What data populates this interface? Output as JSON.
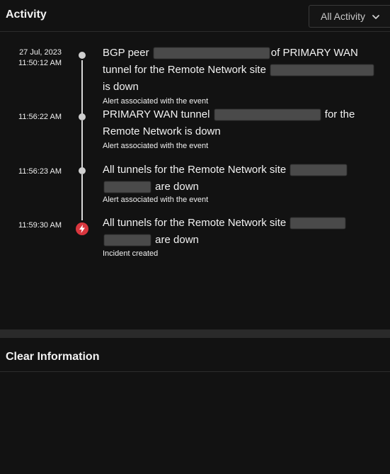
{
  "header": {
    "title": "Activity",
    "filter": {
      "label": "All Activity",
      "icon": "chevron-down-icon"
    }
  },
  "timeline": [
    {
      "date": "27 Jul, 2023",
      "time": "11:50:12 AM",
      "marker": "dot",
      "message": {
        "part1": "BGP peer",
        "part2": "of PRIMARY WAN tunnel for the Remote Network site",
        "part3": "is down"
      },
      "sub": "Alert associated with the event"
    },
    {
      "date": "",
      "time": "11:56:22 AM",
      "marker": "dot",
      "message": {
        "part1": "PRIMARY WAN tunnel",
        "part2": "for the Remote Network is down"
      },
      "sub": "Alert associated with the event"
    },
    {
      "date": "",
      "time": "11:56:23 AM",
      "marker": "dot",
      "message": {
        "part1": "All tunnels for the Remote Network site",
        "part2": "are down"
      },
      "sub": "Alert associated with the event"
    },
    {
      "date": "",
      "time": "11:59:30 AM",
      "marker": "incident",
      "marker_color": "#d9363e",
      "message": {
        "part1": "All tunnels for the Remote Network site",
        "part2": "are down"
      },
      "sub": "Incident created"
    }
  ],
  "clear_section": {
    "title": "Clear Information"
  }
}
